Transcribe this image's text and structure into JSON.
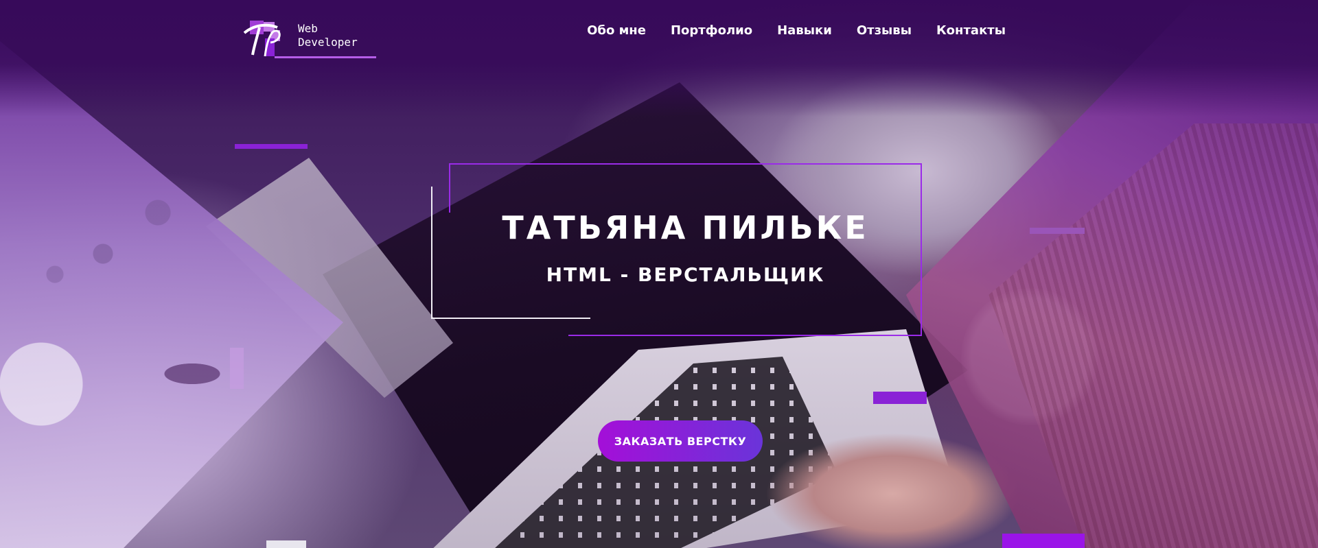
{
  "header": {
    "logo": {
      "monogram": "TP",
      "text_line1": "Web",
      "text_line2": "Developer"
    },
    "nav": [
      {
        "label": "Обо мне"
      },
      {
        "label": "Портфолио"
      },
      {
        "label": "Навыки"
      },
      {
        "label": "Отзывы"
      },
      {
        "label": "Контакты"
      }
    ]
  },
  "hero": {
    "title": "ТАТЬЯНА ПИЛЬКЕ",
    "subtitle": "HTML - ВЕРСТАЛЬЩИК",
    "cta_label": "ЗАКАЗАТЬ ВЕРСТКУ"
  },
  "colors": {
    "accent_purple": "#9a2be8",
    "header_bg": "#370a5a",
    "cta_gradient_start": "#a40fd8",
    "cta_gradient_end": "#6a34d9"
  }
}
